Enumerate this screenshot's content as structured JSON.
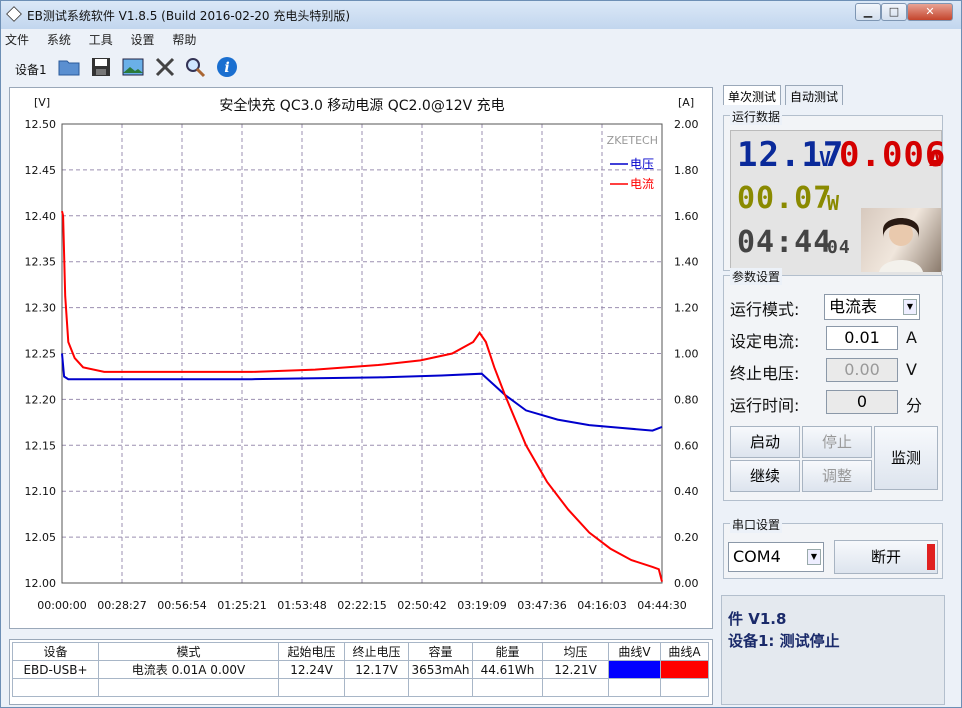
{
  "window": {
    "title": "EB测试系统软件 V1.8.5 (Build 2016-02-20 充电头特别版)",
    "min_label": "▁",
    "max_label": "□",
    "close_label": "✕"
  },
  "menu": [
    "文件",
    "系统",
    "工具",
    "设置",
    "帮助"
  ],
  "toolbar": {
    "device_tab": "设备1",
    "icons": [
      "folder-icon",
      "save-icon",
      "picture-icon",
      "tools-icon",
      "magnifier-icon",
      "info-icon"
    ]
  },
  "chart_data": {
    "type": "line",
    "title": "安全快充 QC3.0 移动电源 QC2.0@12V 充电",
    "watermark": "ZKETECH",
    "ylabel_left": "[V]",
    "ylabel_right": "[A]",
    "ylim_left": [
      12.0,
      12.5
    ],
    "ylim_right": [
      0.0,
      2.0
    ],
    "yticks_left": [
      "12.50",
      "12.45",
      "12.40",
      "12.35",
      "12.30",
      "12.25",
      "12.20",
      "12.15",
      "12.10",
      "12.05",
      "12.00"
    ],
    "yticks_right": [
      "2.00",
      "1.80",
      "1.60",
      "1.40",
      "1.20",
      "1.00",
      "0.80",
      "0.60",
      "0.40",
      "0.20",
      "0.00"
    ],
    "xticks": [
      "00:00:00",
      "00:28:27",
      "00:56:54",
      "01:25:21",
      "01:53:48",
      "02:22:15",
      "02:50:42",
      "03:19:09",
      "03:47:36",
      "04:16:03",
      "04:44:30"
    ],
    "xlim_minutes": [
      0,
      284.5
    ],
    "grid": true,
    "legend_position": "top-right",
    "series": [
      {
        "name": "电压",
        "color": "#0000cc",
        "axis": "left",
        "x_minutes": [
          0,
          1,
          3,
          8,
          20,
          40,
          60,
          90,
          120,
          150,
          180,
          199,
          210,
          220,
          235,
          250,
          265,
          280,
          284.5
        ],
        "y": [
          12.25,
          12.225,
          12.222,
          12.222,
          12.222,
          12.222,
          12.222,
          12.222,
          12.223,
          12.224,
          12.226,
          12.228,
          12.205,
          12.188,
          12.178,
          12.172,
          12.169,
          12.166,
          12.17
        ]
      },
      {
        "name": "电流",
        "color": "#ff0000",
        "axis": "right",
        "x_minutes": [
          0,
          0.5,
          1.5,
          3,
          6,
          10,
          20,
          40,
          60,
          90,
          120,
          150,
          170,
          185,
          195,
          198,
          201,
          205,
          210,
          220,
          230,
          240,
          250,
          260,
          270,
          280,
          283,
          284.5
        ],
        "y": [
          1.62,
          1.6,
          1.25,
          1.05,
          0.98,
          0.94,
          0.92,
          0.92,
          0.92,
          0.92,
          0.93,
          0.95,
          0.97,
          1.0,
          1.05,
          1.09,
          1.05,
          0.94,
          0.82,
          0.6,
          0.44,
          0.32,
          0.22,
          0.15,
          0.1,
          0.07,
          0.06,
          0.006
        ]
      }
    ]
  },
  "summary_table": {
    "headers": [
      "设备",
      "模式",
      "起始电压",
      "终止电压",
      "容量",
      "能量",
      "均压",
      "曲线V",
      "曲线A"
    ],
    "row": [
      "EBD-USB+",
      "电流表  0.01A  0.00V",
      "12.24V",
      "12.17V",
      "3653mAh",
      "44.61Wh",
      "12.21V",
      "",
      ""
    ],
    "curve_v_color": "#0000ff",
    "curve_a_color": "#ff0000"
  },
  "right_panel": {
    "tabs": [
      "单次测试",
      "自动测试"
    ],
    "run_data_label": "运行数据",
    "voltage": "12.17",
    "voltage_unit": "V",
    "current": "0.006",
    "current_unit": "A",
    "power": "00.07",
    "power_unit": "W",
    "time": "04:44",
    "time_sub": "04",
    "voltage_color": "#0a2a9a",
    "current_color": "#d40000",
    "power_color": "#8a8a00",
    "time_color": "#444444"
  },
  "params": {
    "group_label": "参数设置",
    "mode_label": "运行模式:",
    "mode_value": "电流表",
    "set_current_label": "设定电流:",
    "set_current_value": "0.01",
    "set_current_unit": "A",
    "end_voltage_label": "终止电压:",
    "end_voltage_value": "0.00",
    "end_voltage_unit": "V",
    "run_time_label": "运行时间:",
    "run_time_value": "0",
    "run_time_unit": "分",
    "btn_start": "启动",
    "btn_stop": "停止",
    "btn_monitor": "监测",
    "btn_continue": "继续",
    "btn_adjust": "调整"
  },
  "serial": {
    "group_label": "串口设置",
    "port": "COM4",
    "disconnect": "断开"
  },
  "status": {
    "line1": "件 V1.8",
    "line2": "设备1: 测试停止"
  }
}
